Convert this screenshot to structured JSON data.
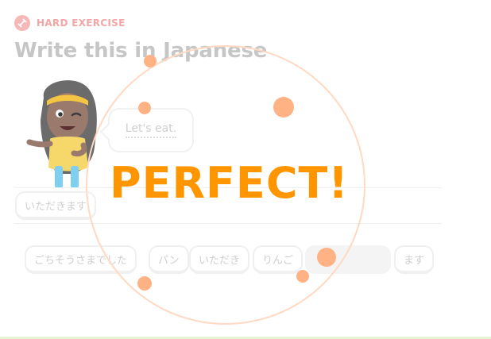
{
  "header": {
    "exercise_type": "HARD EXERCISE",
    "title": "Write this in Japanese"
  },
  "prompt": {
    "character_icon": "character-icon",
    "bubble_text": "Let's eat."
  },
  "answer": {
    "selected_tiles": [
      "いただきます"
    ]
  },
  "word_bank": {
    "tiles": [
      {
        "label": "ごちそうさまでした"
      },
      {
        "label": "パン"
      },
      {
        "label": "いただき"
      },
      {
        "label": "りんご"
      },
      {
        "label": ""
      },
      {
        "label": "ます"
      }
    ]
  },
  "feedback": {
    "message": "PERFECT!"
  },
  "colors": {
    "accent": "#ff9600",
    "burst": "#ffb385",
    "tag": "#f4a6a6",
    "muted_text": "#cfcfcf"
  }
}
